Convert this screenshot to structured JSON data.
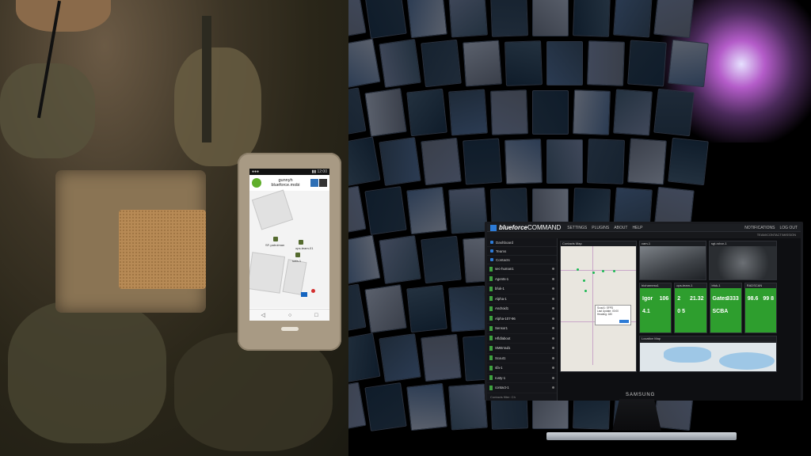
{
  "phone": {
    "app_title": "gunnyh",
    "app_subtitle": "blueforce.mobi",
    "map_labels": [
      "SF-patrolman",
      "ops-team-01",
      "sofa-1"
    ]
  },
  "monitor_brand": "SAMSUNG",
  "app": {
    "logo_bold": "blueforce",
    "logo_light": "COMMAND",
    "nav": [
      "SETTINGS",
      "PLUGINS",
      "ABOUT",
      "HELP"
    ],
    "right_nav": [
      "NOTIFICATIONS",
      "LOG OUT"
    ],
    "sub_right": "TEAM/CONTACT/MISSION",
    "sidebar": [
      "Dashboard",
      "Teams",
      "Contacts"
    ],
    "contacts": [
      "sec-human1",
      "Agents-1",
      "bfuk-1",
      "Alpha-1",
      "Android1",
      "Alpha-107-96",
      "Sensor1",
      "Hfldlaboot",
      "SMErrad1",
      "Scout1",
      "sfa-1",
      "rusty-1",
      "contact-1"
    ],
    "sidebar_footer": "Contacts filter: Ch",
    "panels": {
      "map_title": "Contacts Map",
      "cam1": "cam-1",
      "cam2": "sgt-robor-1",
      "popup_lines": [
        "Scout1: SFPD",
        "Last Update: 00:00",
        "Heading: 180",
        "Status: OK"
      ]
    },
    "stats": [
      {
        "title": "bioharness1",
        "name": "Igor",
        "val": "106",
        "sub": "4.1"
      },
      {
        "title": "ops-team-1",
        "name": "2",
        "val": "21.32",
        "sub": "0 5"
      },
      {
        "title": "bfuk-1",
        "name": "Gates",
        "val": "3333",
        "sub": "SCBA"
      },
      {
        "title": "RADSCAN",
        "name": "98.6",
        "val": "99 8",
        "sub": ""
      }
    ],
    "map2_title": "Location Map"
  }
}
